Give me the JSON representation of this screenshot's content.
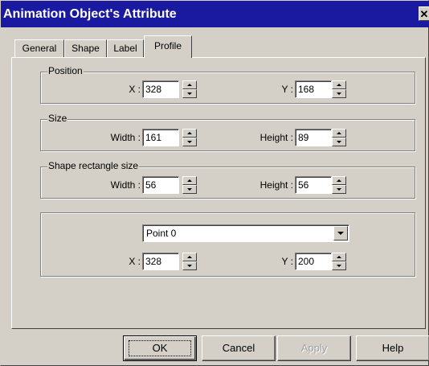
{
  "window": {
    "title": "Animation Object's Attribute",
    "close_glyph": "✕"
  },
  "tabs": [
    {
      "label": "General"
    },
    {
      "label": "Shape"
    },
    {
      "label": "Label"
    },
    {
      "label": "Profile",
      "active": true
    }
  ],
  "position": {
    "title": "Position",
    "x_label": "X :",
    "x_value": "328",
    "y_label": "Y :",
    "y_value": "168"
  },
  "size": {
    "title": "Size",
    "width_label": "Width :",
    "width_value": "161",
    "height_label": "Height :",
    "height_value": "89"
  },
  "shape_rect": {
    "title": "Shape rectangle size",
    "width_label": "Width :",
    "width_value": "56",
    "height_label": "Height :",
    "height_value": "56"
  },
  "points": {
    "selected_point": "Point 0",
    "x_label": "X :",
    "x_value": "328",
    "y_label": "Y :",
    "y_value": "200"
  },
  "buttons": {
    "ok": "OK",
    "cancel": "Cancel",
    "apply": "Apply",
    "help": "Help"
  }
}
